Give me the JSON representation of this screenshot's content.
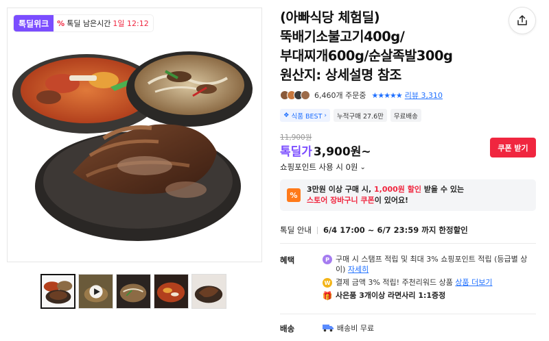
{
  "gallery": {
    "deal_logo": "톡딜위크",
    "timer_icon": "percent-icon",
    "timer_label": "톡딜 남은시간",
    "timer_value": "1일 12:12",
    "thumbnails": [
      "thumb-main",
      "thumb-video",
      "thumb-noodle",
      "thumb-stew",
      "thumb-jokbal"
    ]
  },
  "product": {
    "title_lines": [
      "(아빠식당 체험딜)",
      "뚝배기소불고기400g/",
      "부대찌개600g/순살족발300g",
      "원산지: 상세설명 참조"
    ],
    "orders": "6,460개 주문중",
    "stars": "★★★★★",
    "review_text": "리뷰 3,310",
    "tags": [
      "식품 BEST",
      "누적구매 27.6만",
      "무료배송"
    ],
    "price_original": "11,900원",
    "price_label": "톡딜가",
    "price_value": "3,900원~",
    "coupon_button": "쿠폰 받기",
    "points_text": "쇼핑포인트 사용 시 0원",
    "coupon_notice_line1_a": "3만원 이상 구매 시, ",
    "coupon_notice_line1_hl": "1,000원 할인",
    "coupon_notice_line1_b": " 받을 수 있는",
    "coupon_notice_line2_hl": "스토어 장바구니 쿠폰",
    "coupon_notice_line2_b": "이 있어요!",
    "deal_info_label": "톡딜 안내",
    "deal_info_period": "6/4 17:00 ~ 6/7 23:59 까지 한정할인"
  },
  "benefits": {
    "label": "혜택",
    "item1_text": "구매 시 스탬프 적립 및 최대 3% 쇼핑포인트 적립 (등급별 상이)",
    "item1_link": "자세히",
    "item2_text": "결제 금액 3% 적립! 주천리워드 상품",
    "item2_link": "상품 더보기",
    "item3_text": "사은품 3개이상 라면사리 1:1증정"
  },
  "shipping": {
    "label": "배송",
    "text": "배송비 무료"
  },
  "colors": {
    "accent_purple": "#7b4dff",
    "accent_red": "#f0263f",
    "link_blue": "#1e6fff"
  }
}
